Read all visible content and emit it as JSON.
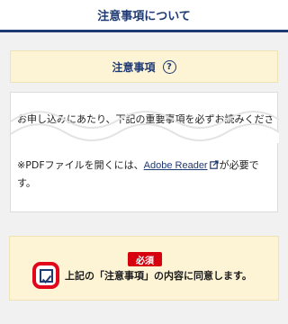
{
  "header": {
    "title": "注意事項について"
  },
  "notice": {
    "title": "注意事項",
    "help_icon": "?"
  },
  "content": {
    "paragraph": "お申し込みにあたり、下記の重要事項を必ずお読みください。",
    "pdf_note_prefix": "※PDFファイルを開くには、",
    "pdf_link": "Adobe Reader",
    "pdf_note_suffix": "が必要です。"
  },
  "agreement": {
    "required_badge": "必須",
    "checkbox_label": "上記の「注意事項」の内容に同意します。",
    "checked": true
  },
  "colors": {
    "navy": "#1f3a73",
    "cream": "#fdf4d6",
    "red": "#e1061a",
    "badge_red": "#d7000f"
  }
}
